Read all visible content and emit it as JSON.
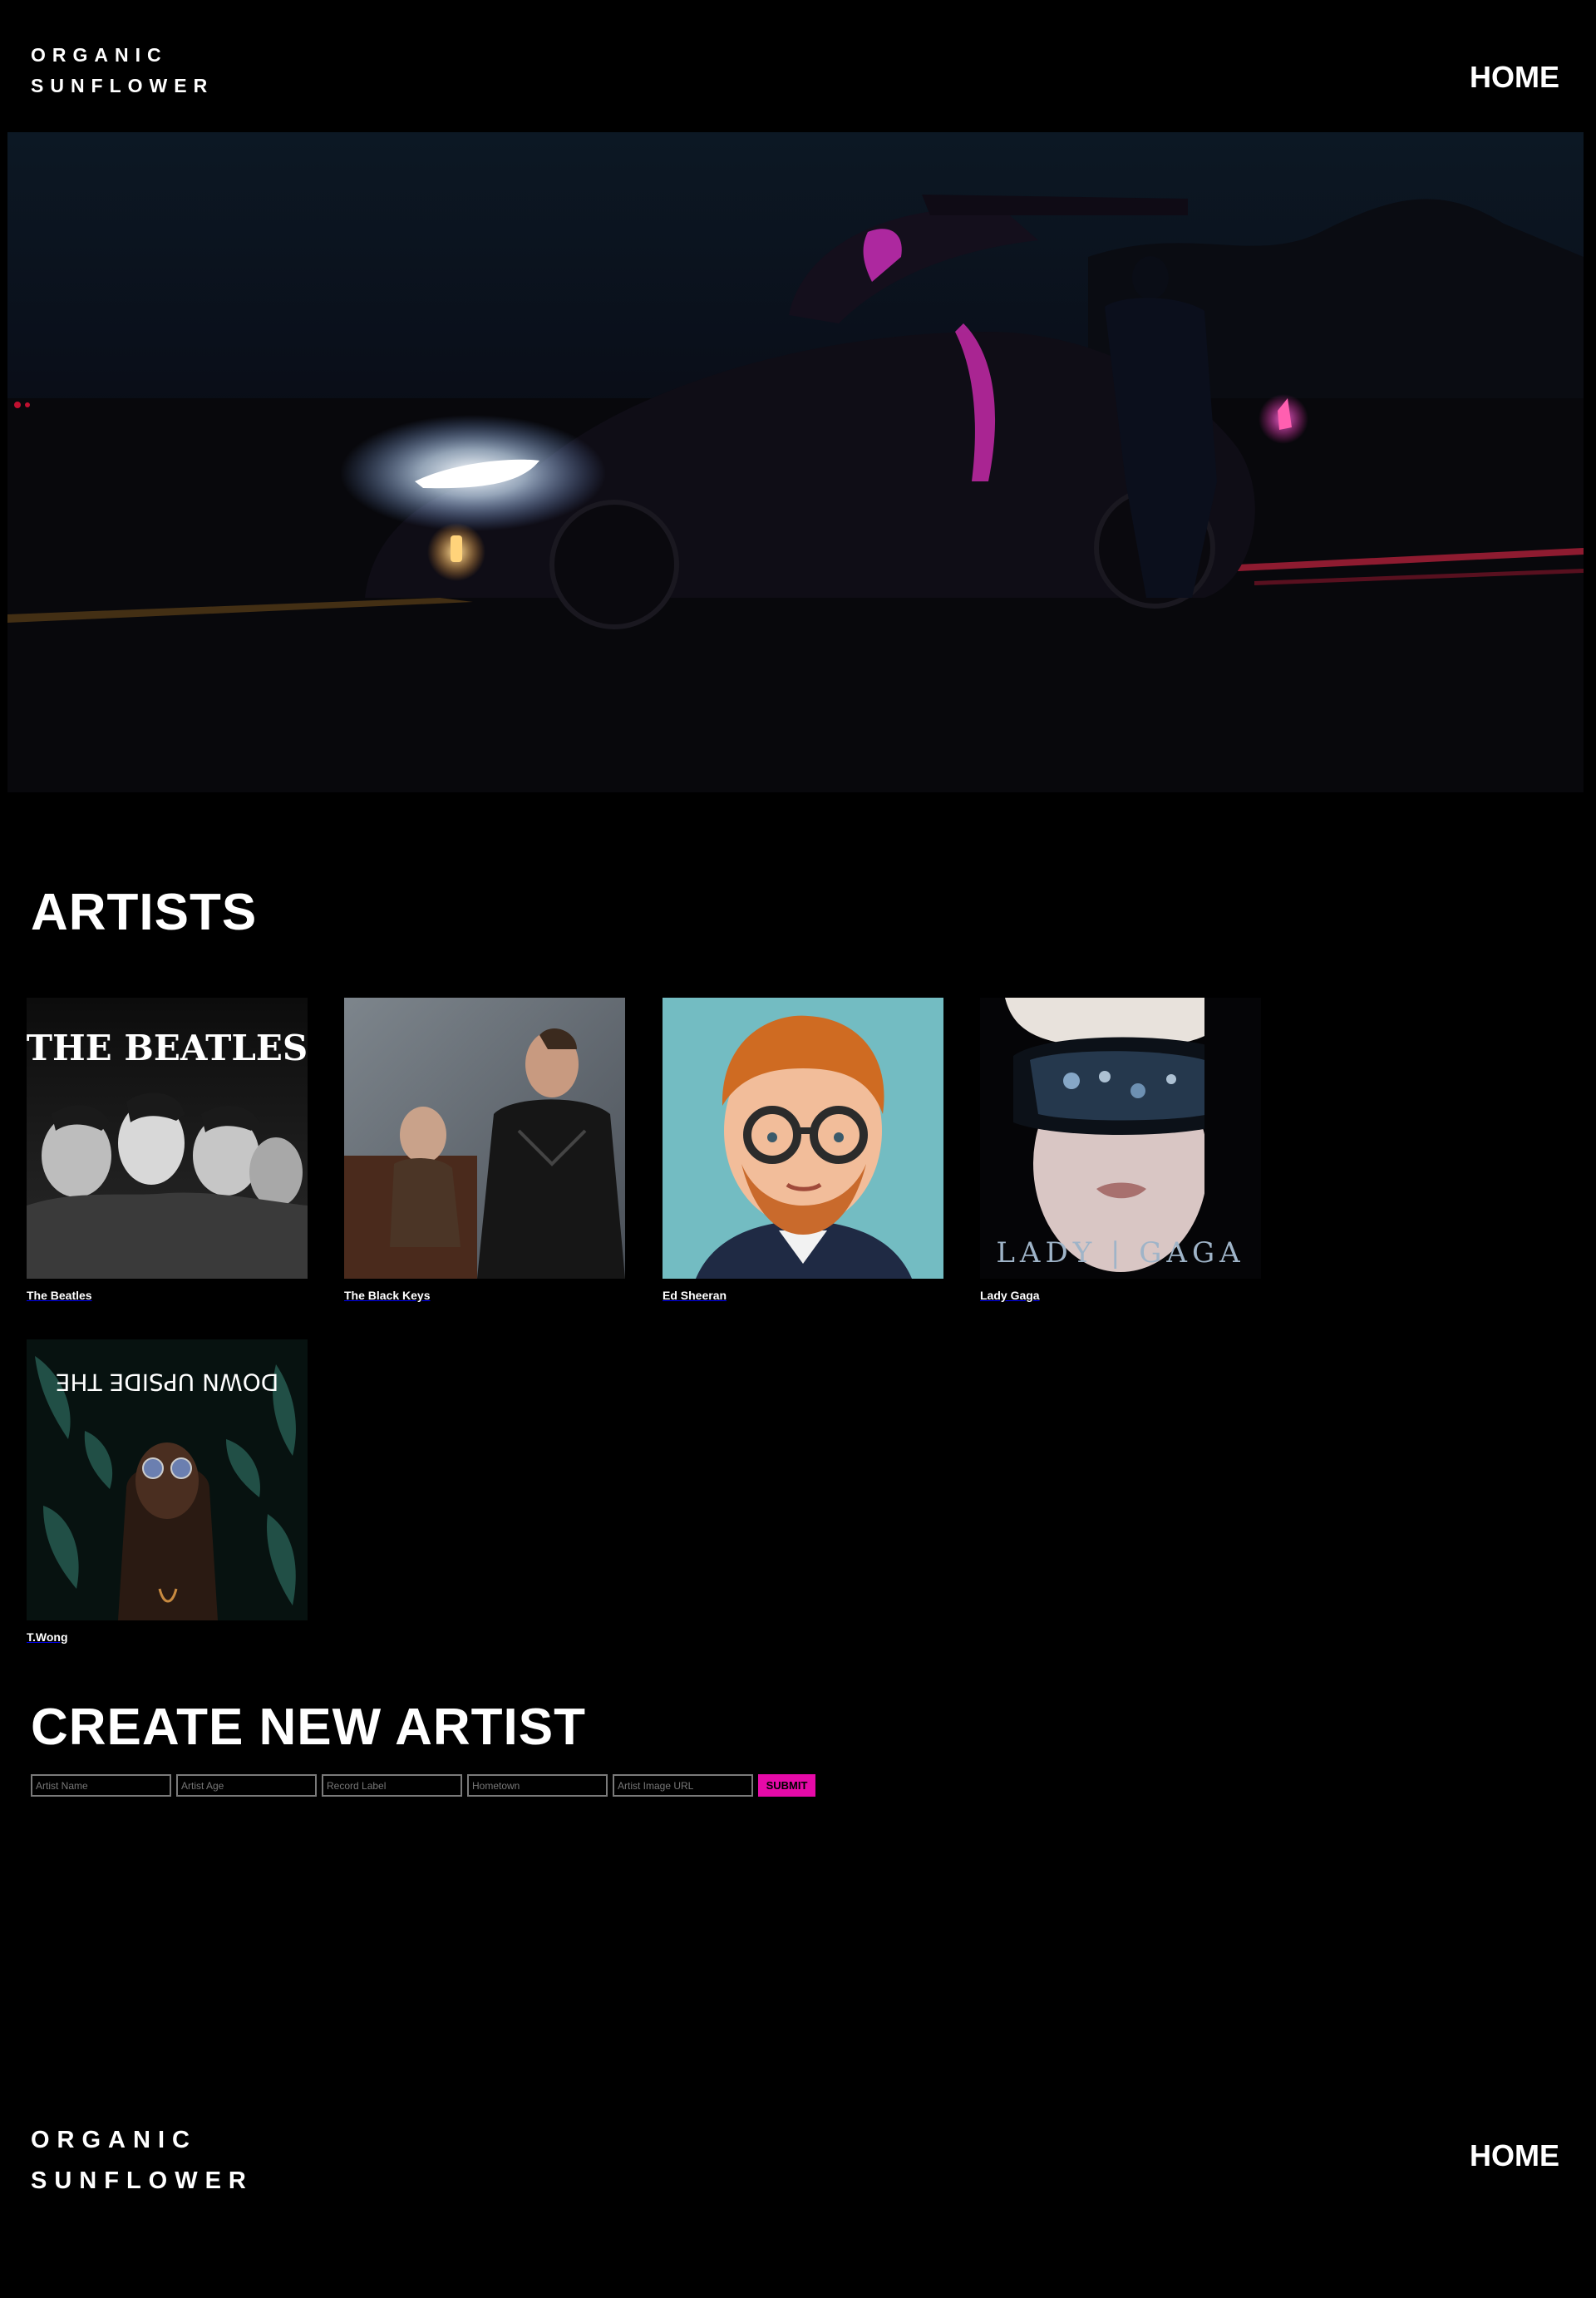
{
  "header": {
    "logo_line1": "ORGANIC",
    "logo_line2": "SUNFLOWER",
    "nav_home": "HOME"
  },
  "artists": {
    "title": "ARTISTS",
    "items": [
      {
        "name": "The Beatles",
        "image_text": "THE BEATLES"
      },
      {
        "name": "The Black Keys"
      },
      {
        "name": "Ed Sheeran"
      },
      {
        "name": "Lady Gaga",
        "image_text": "LADY | GAGA"
      },
      {
        "name": "T.Wong",
        "image_text": "DOWN UPSIDE THE"
      }
    ]
  },
  "create": {
    "title": "CREATE NEW ARTIST",
    "fields": [
      {
        "placeholder": "Artist Name"
      },
      {
        "placeholder": "Artist Age"
      },
      {
        "placeholder": "Record Label"
      },
      {
        "placeholder": "Hometown"
      },
      {
        "placeholder": "Artist Image URL"
      }
    ],
    "submit_label": "SUBMIT"
  },
  "footer": {
    "logo_line1": "ORGANIC",
    "logo_line2": "SUNFLOWER",
    "nav_home": "HOME"
  },
  "colors": {
    "background": "#000000",
    "text": "#ffffff",
    "accent": "#e60aa8"
  }
}
